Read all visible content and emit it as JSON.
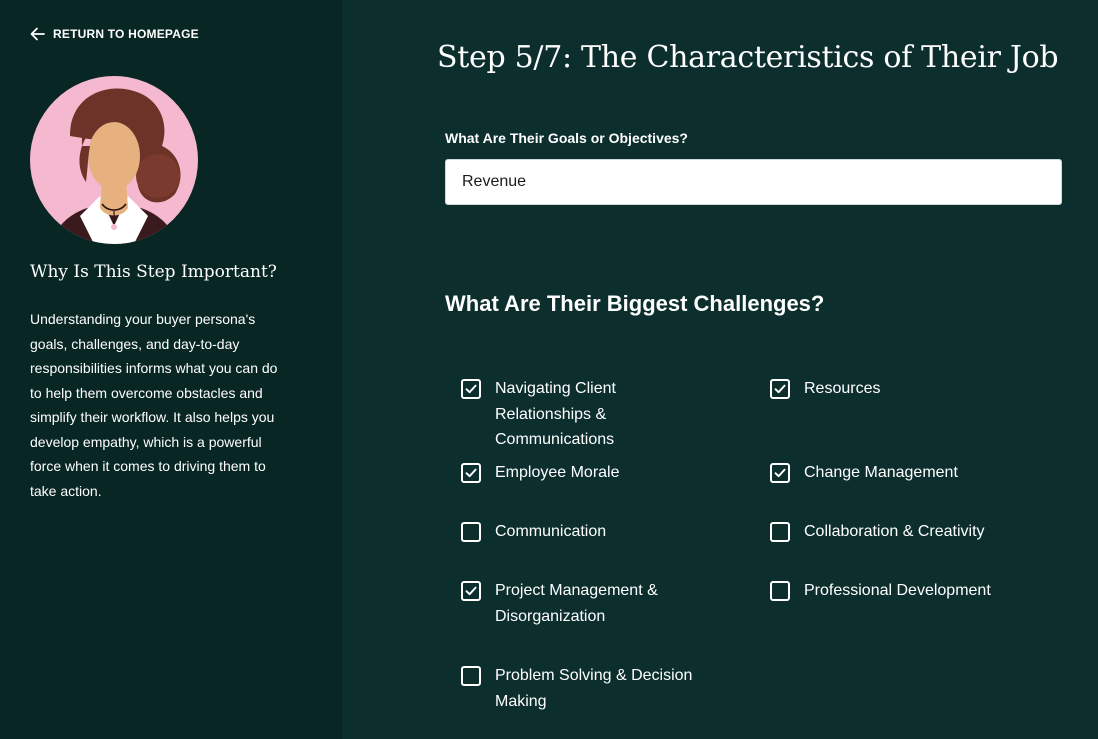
{
  "sidebar": {
    "return_label": "RETURN TO HOMEPAGE",
    "why_title": "Why Is This Step Important?",
    "why_text": "Understanding your buyer persona's goals, challenges, and day-to-day responsibilities informs what you can do to help them overcome obstacles and simplify their workflow. It also helps you develop empathy, which is a powerful force when it comes to driving them to take action."
  },
  "main": {
    "step_title": "Step 5/7: The Characteristics of Their Job",
    "goals_label": "What Are Their Goals or Objectives?",
    "goals_value": "Revenue",
    "challenges_title": "What Are Their Biggest Challenges?",
    "challenges": [
      {
        "label": "Navigating Client Relationships & Communications",
        "checked": true
      },
      {
        "label": "Resources",
        "checked": true
      },
      {
        "label": "Employee Morale",
        "checked": true
      },
      {
        "label": "Change Management",
        "checked": true
      },
      {
        "label": "Communication",
        "checked": false
      },
      {
        "label": "Collaboration & Creativity",
        "checked": false
      },
      {
        "label": "Project Management & Disorganization",
        "checked": true
      },
      {
        "label": "Professional Development",
        "checked": false
      },
      {
        "label": "Problem Solving & Decision Making",
        "checked": false
      }
    ]
  },
  "colors": {
    "sidebar_bg": "#082624",
    "main_bg": "#0c2e2d",
    "avatar_bg": "#f4b8cf",
    "text": "#ffffff"
  },
  "icons": {
    "return": "arrow-left-icon",
    "check": "checkmark-icon"
  }
}
